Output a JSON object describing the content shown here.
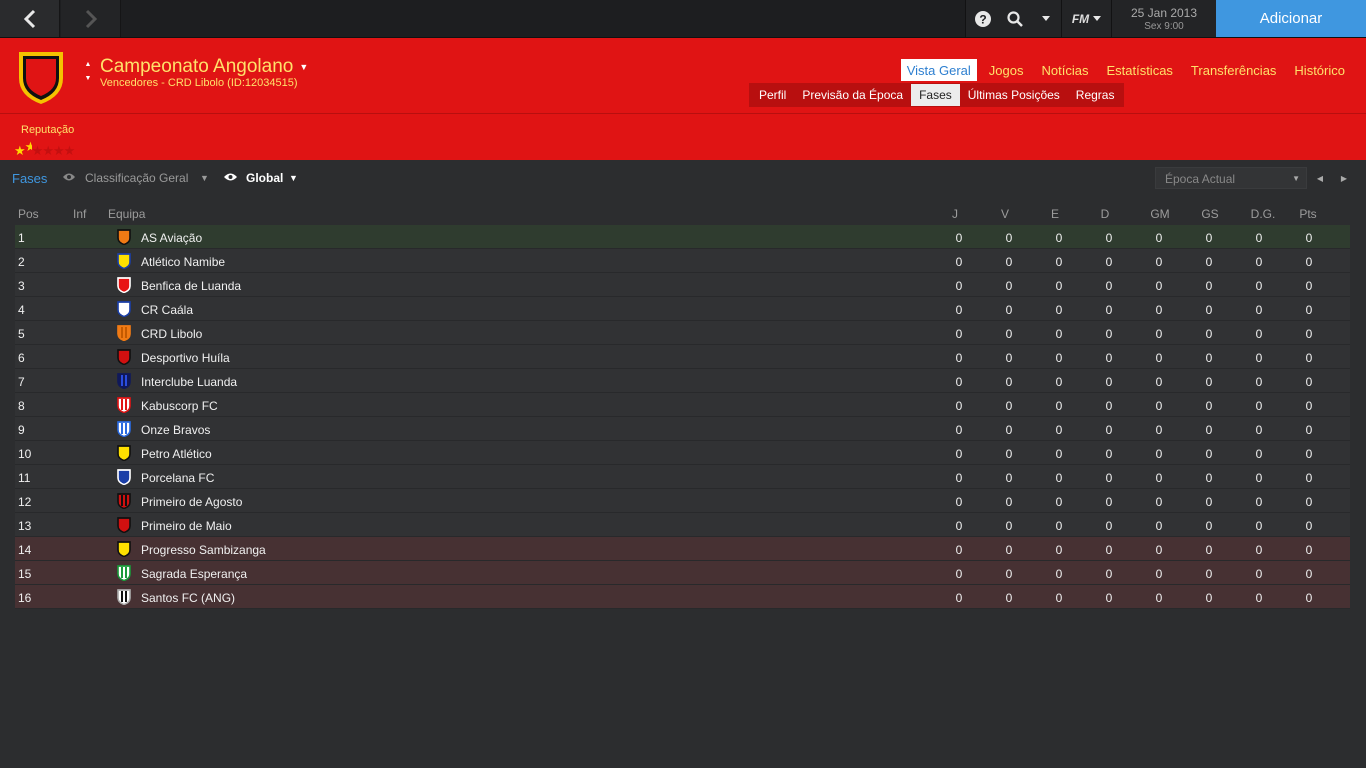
{
  "topbar": {
    "fm_label": "FM",
    "date_line1": "25 Jan 2013",
    "date_line2": "Sex 9:00",
    "continue_label": "Adicionar"
  },
  "header": {
    "title": "Campeonato Angolano",
    "subtitle": "Vencedores - CRD Libolo (ID:12034515)",
    "brand_color": "#e01414",
    "title_color": "#ffe16a",
    "tabs": [
      "Vista Geral",
      "Jogos",
      "Notícias",
      "Estatísticas",
      "Transferências",
      "Histórico"
    ],
    "active_tab": "Vista Geral",
    "subtabs": [
      "Perfil",
      "Previsão da Época",
      "Fases",
      "Últimas Posições",
      "Regras"
    ],
    "active_subtab": "Fases",
    "reputation_label": "Reputação",
    "reputation_stars": 1.5,
    "reputation_max": 5
  },
  "filters": {
    "fases": "Fases",
    "classification": "Classificação Geral",
    "scope": "Global",
    "season_placeholder": "Época Actual"
  },
  "table": {
    "columns": {
      "pos": "Pos",
      "inf": "Inf",
      "team": "Equipa",
      "j": "J",
      "v": "V",
      "e": "E",
      "d": "D",
      "gm": "GM",
      "gs": "GS",
      "dg": "D.G.",
      "pts": "Pts"
    },
    "rows": [
      {
        "pos": "1",
        "team": "AS Aviação",
        "zone": "top",
        "badge": "shield-orange",
        "stats": [
          "0",
          "0",
          "0",
          "0",
          "0",
          "0",
          "0",
          "0"
        ]
      },
      {
        "pos": "2",
        "team": "Atlético Namibe",
        "zone": "mid",
        "badge": "shield-yellow-blue",
        "stats": [
          "0",
          "0",
          "0",
          "0",
          "0",
          "0",
          "0",
          "0"
        ]
      },
      {
        "pos": "3",
        "team": "Benfica de Luanda",
        "zone": "mid",
        "badge": "shield-red",
        "stats": [
          "0",
          "0",
          "0",
          "0",
          "0",
          "0",
          "0",
          "0"
        ]
      },
      {
        "pos": "4",
        "team": "CR Caála",
        "zone": "mid",
        "badge": "shield-blue-white",
        "stats": [
          "0",
          "0",
          "0",
          "0",
          "0",
          "0",
          "0",
          "0"
        ]
      },
      {
        "pos": "5",
        "team": "CRD Libolo",
        "zone": "mid",
        "badge": "shield-orange-stripe",
        "stats": [
          "0",
          "0",
          "0",
          "0",
          "0",
          "0",
          "0",
          "0"
        ]
      },
      {
        "pos": "6",
        "team": "Desportivo Huíla",
        "zone": "mid",
        "badge": "shield-red-dark",
        "stats": [
          "0",
          "0",
          "0",
          "0",
          "0",
          "0",
          "0",
          "0"
        ]
      },
      {
        "pos": "7",
        "team": "Interclube Luanda",
        "zone": "mid",
        "badge": "shield-navy-stripe",
        "stats": [
          "0",
          "0",
          "0",
          "0",
          "0",
          "0",
          "0",
          "0"
        ]
      },
      {
        "pos": "8",
        "team": "Kabuscorp FC",
        "zone": "mid",
        "badge": "shield-red-white-stripe",
        "stats": [
          "0",
          "0",
          "0",
          "0",
          "0",
          "0",
          "0",
          "0"
        ]
      },
      {
        "pos": "9",
        "team": "Onze Bravos",
        "zone": "mid",
        "badge": "shield-blue-white-stripe",
        "stats": [
          "0",
          "0",
          "0",
          "0",
          "0",
          "0",
          "0",
          "0"
        ]
      },
      {
        "pos": "10",
        "team": "Petro Atlético",
        "zone": "mid",
        "badge": "shield-yellow",
        "stats": [
          "0",
          "0",
          "0",
          "0",
          "0",
          "0",
          "0",
          "0"
        ]
      },
      {
        "pos": "11",
        "team": "Porcelana FC",
        "zone": "mid",
        "badge": "shield-blue",
        "stats": [
          "0",
          "0",
          "0",
          "0",
          "0",
          "0",
          "0",
          "0"
        ]
      },
      {
        "pos": "12",
        "team": "Primeiro de Agosto",
        "zone": "mid",
        "badge": "shield-red-black-stripe",
        "stats": [
          "0",
          "0",
          "0",
          "0",
          "0",
          "0",
          "0",
          "0"
        ]
      },
      {
        "pos": "13",
        "team": "Primeiro de Maio",
        "zone": "mid",
        "badge": "shield-red-dark",
        "stats": [
          "0",
          "0",
          "0",
          "0",
          "0",
          "0",
          "0",
          "0"
        ]
      },
      {
        "pos": "14",
        "team": "Progresso Sambizanga",
        "zone": "rel",
        "badge": "shield-yellow-black",
        "stats": [
          "0",
          "0",
          "0",
          "0",
          "0",
          "0",
          "0",
          "0"
        ]
      },
      {
        "pos": "15",
        "team": "Sagrada Esperança",
        "zone": "rel",
        "badge": "shield-green-white-stripe",
        "stats": [
          "0",
          "0",
          "0",
          "0",
          "0",
          "0",
          "0",
          "0"
        ]
      },
      {
        "pos": "16",
        "team": "Santos FC (ANG)",
        "zone": "rel",
        "badge": "shield-black-white-stripe",
        "stats": [
          "0",
          "0",
          "0",
          "0",
          "0",
          "0",
          "0",
          "0"
        ]
      }
    ]
  },
  "colors": {
    "accent": "#3f97e0",
    "promotion_row": "#2f3c2f",
    "relegation_row": "#473133"
  }
}
